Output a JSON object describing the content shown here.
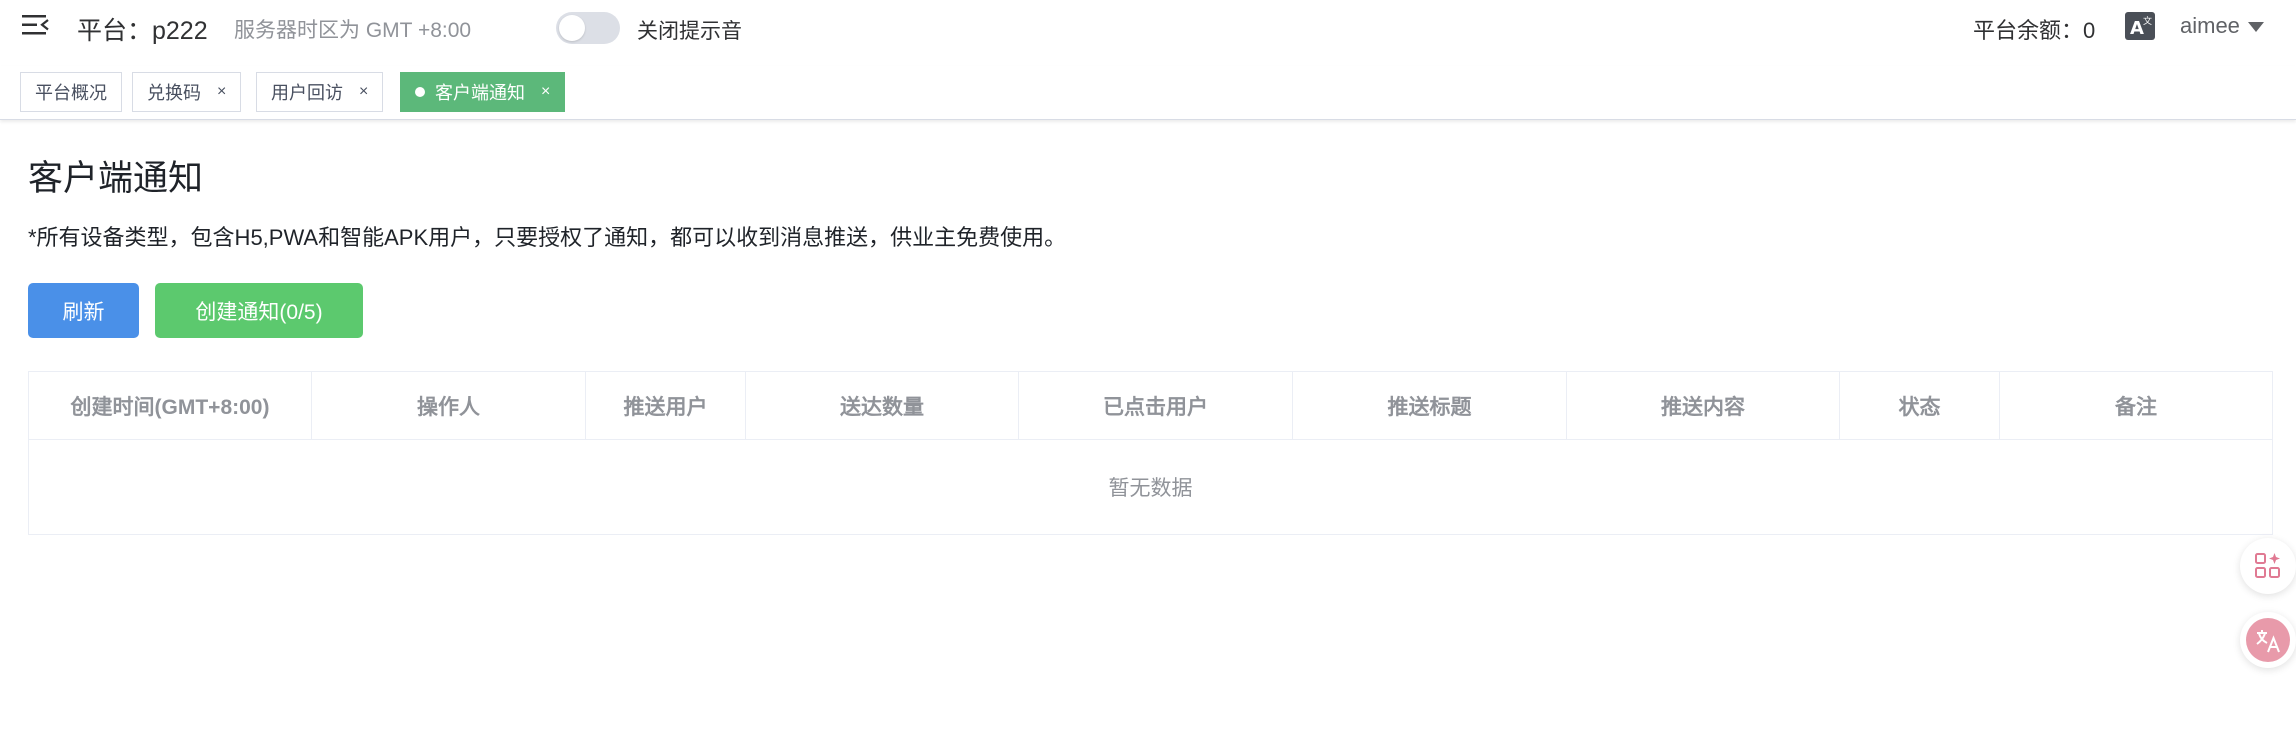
{
  "header": {
    "platform_label": "平台：p222",
    "timezone_text": "服务器时区为 GMT +8:00",
    "mute_toggle_label": "关闭提示音",
    "balance_text": "平台余额：0",
    "username": "aimee",
    "icons": [
      "hamburger-icon",
      "translate-icon",
      "caret-down-icon"
    ]
  },
  "tags": [
    {
      "label": "平台概况",
      "closable": false,
      "active": false
    },
    {
      "label": "兑换码",
      "closable": true,
      "active": false
    },
    {
      "label": "用户回访",
      "closable": true,
      "active": false
    },
    {
      "label": "客户端通知",
      "closable": true,
      "active": true
    }
  ],
  "tag_close_glyph": "×",
  "main": {
    "title": "客户端通知",
    "description": "*所有设备类型，包含H5,PWA和智能APK用户，只要授权了通知，都可以收到消息推送，供业主免费使用。",
    "refresh_button": "刷新",
    "create_button": "创建通知(0/5)"
  },
  "table": {
    "columns": [
      "创建时间(GMT+8:00)",
      "操作人",
      "推送用户",
      "送达数量",
      "已点击用户",
      "推送标题",
      "推送内容",
      "状态",
      "备注"
    ],
    "rows": [],
    "empty_text": "暂无数据"
  },
  "floating": {
    "icons": [
      "apps-sparkle-icon",
      "language-switch-icon"
    ]
  },
  "colors": {
    "active_tag": "#5cb87a",
    "primary_button": "#4a90e8",
    "success_button": "#5cc96e",
    "muted_text": "#909399"
  }
}
